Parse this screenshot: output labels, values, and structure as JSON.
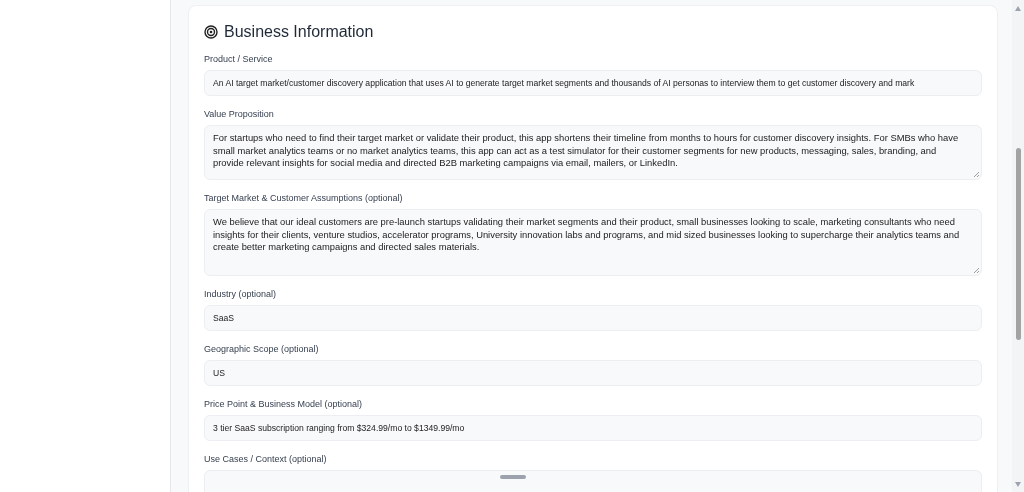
{
  "section": {
    "title": "Business Information"
  },
  "fields": [
    {
      "label": "Product / Service",
      "kind": "input",
      "value": "An AI target market/customer discovery application that uses AI to generate target market segments and thousands of AI personas to interview them to get customer discovery and mark"
    },
    {
      "label": "Value Proposition",
      "kind": "textarea",
      "value": "For startups who need to find their target market or validate their product, this app shortens their timeline from months to hours for customer discovery insights. For SMBs who have small market analytics teams or no market analytics teams, this app can act as a test simulator for their customer segments for new products, messaging, sales, branding, and provide relevant insights for social media and directed B2B marketing campaigns via email, mailers, or LinkedIn."
    },
    {
      "label": "Target Market & Customer Assumptions (optional)",
      "kind": "textarea",
      "value": "We believe that our ideal customers are pre-launch startups validating their market segments and their product, small businesses looking to scale, marketing consultants who need insights for their clients, venture studios, accelerator programs, University innovation labs and programs, and mid sized businesses looking to supercharge their analytics teams and create better marketing campaigns and directed sales materials."
    },
    {
      "label": "Industry (optional)",
      "kind": "input",
      "value": "SaaS"
    },
    {
      "label": "Geographic Scope (optional)",
      "kind": "input",
      "value": "US"
    },
    {
      "label": "Price Point & Business Model (optional)",
      "kind": "input",
      "value": "3 tier SaaS subscription ranging from $324.99/mo to $1349.99/mo"
    },
    {
      "label": "Use Cases / Context (optional)",
      "kind": "input"
    }
  ]
}
